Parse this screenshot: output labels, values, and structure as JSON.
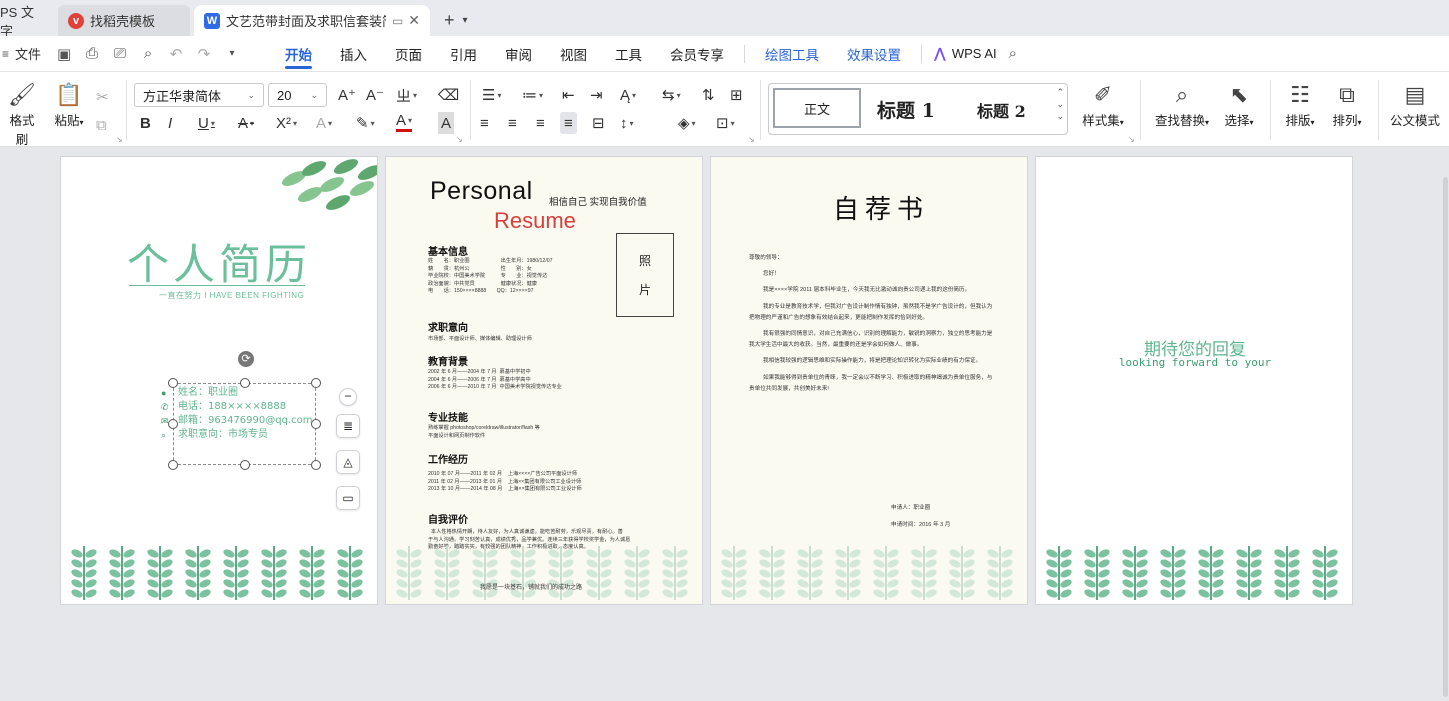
{
  "tabs": {
    "wps_label": "PS 文字",
    "template_label": "找稻壳模板",
    "doc_label": "文艺范带封面及求职信套装简历"
  },
  "menu": {
    "file": "文件",
    "tabs": [
      "开始",
      "插入",
      "页面",
      "引用",
      "审阅",
      "视图",
      "工具",
      "会员专享"
    ],
    "context_tabs": [
      "绘图工具",
      "效果设置"
    ],
    "ai": "WPS AI"
  },
  "ribbon": {
    "format_painter": "格式刷",
    "paste": "粘贴",
    "font_name": "方正华隶简体",
    "font_size": "20",
    "styles": {
      "normal": "正文",
      "h1": "标题 1",
      "h2": "标题 2"
    },
    "style_set": "样式集",
    "find_replace": "查找替换",
    "select": "选择",
    "layout": "排版",
    "arrange": "排列",
    "official": "公文模式"
  },
  "colors": {
    "accent": "#2a64d6",
    "green": "#6bbf9a",
    "resume_red": "#d63f3b"
  },
  "page1": {
    "title": "个人简历",
    "subtitle": "一直在努力 I HAVE BEEN FIGHTING",
    "info": [
      "姓名：职业圈",
      "电话：188××××8888",
      "邮箱：963476990@qq.com",
      "求职意向：市场专员"
    ]
  },
  "page2": {
    "title": "Personal",
    "subtitle": "Resume",
    "tagline": "相信自己 实现自我价值",
    "photo": [
      "照",
      "片"
    ],
    "sections": {
      "basic": "基本信息",
      "intent": "求职意向",
      "education": "教育背景",
      "skills": "专业技能",
      "work": "工作经历",
      "self": "自我评价"
    },
    "basic_text": "姓　　名：职业圈　　　　　　出生年月：1980/12/07\n籍　　贯：杭州公　　　　　　性　　别：女\n毕业院校：中国美术学院　　　专　　业：视觉传达\n政治面貌：中共党员　　　　　健康状况：健康\n电　　话：150××××8888　　QQ：12××××97",
    "intent_text": "市场部、平面设计师、媒体编辑、助理设计师",
    "education_text": "2002 年 6 月——2004 年 7 月  慕基中学初中\n2004 年 6 月——2006 年 7 月  慕基中学高中\n2006 年 6 月——2010 年 7 月  中国美术学院视觉传达专业",
    "skills_text": "熟练掌握 photoshop/coreldraw/illustrator/flash 等\n平面设计和网页制作软件",
    "work_text": "2010 年 07 月——2011 年 02 月    上海××××广告公司平面设计师\n2011 年 02 月——2013 年 01 月    上海××集团有限公司工业设计师\n2013 年 10 月——2014 年 08 月    上海××集团有限公司工业设计师",
    "self_text": "  本人性格热情开朗，待人友好，为人真诚谦虚。能吃苦耐劳，乐观尽责，有耐心。善\n于与人沟通。学习刻苦认真，成绩优秀，品学兼优。连续三年获得学校奖学金，为人诚恳\n勤奋好学，踏踏实实，有较强的团队精神，工作积极进取，态度认真。",
    "footer": "我愿是一块基石，铺就我们的成功之路"
  },
  "page3": {
    "title": "自荐书",
    "greeting": "尊敬的领导：",
    "paragraphs": [
      "您好！",
      "我是××××学院 2011 届本科毕业生，今天我无比激动诚向贵公司递上我的这份简历。",
      "我的专业是教育技术学，但我对广告设计制作情有独钟，虽然我不是学广告设计的，但我认为把物理的严谨和广告的想象有效结合起来，更能把制作发挥的恰到好处。",
      "我有很强的同情意识，对自己充满信心，识别的理解能力，敏锐的洞察力，独立的思考能力是我大学生活中最大的收获。当然，最重要的还是学会如何做人、做事。",
      "我相信我较强的逻辑思维和实际操作能力，将是把理论知识转化为实际业绩的有力保证。",
      "如果我能够得到贵单位的青睐，我一定会以不断学习、积极进取的精神竭诚为贵单位服务，与贵单位共同发展，共创美好未来!"
    ],
    "applicant": "申请人：职业圈",
    "date": "申请时间：2016 年 3 月"
  },
  "page4": {
    "cn": "期待您的回复",
    "en": "looking forward to your"
  }
}
